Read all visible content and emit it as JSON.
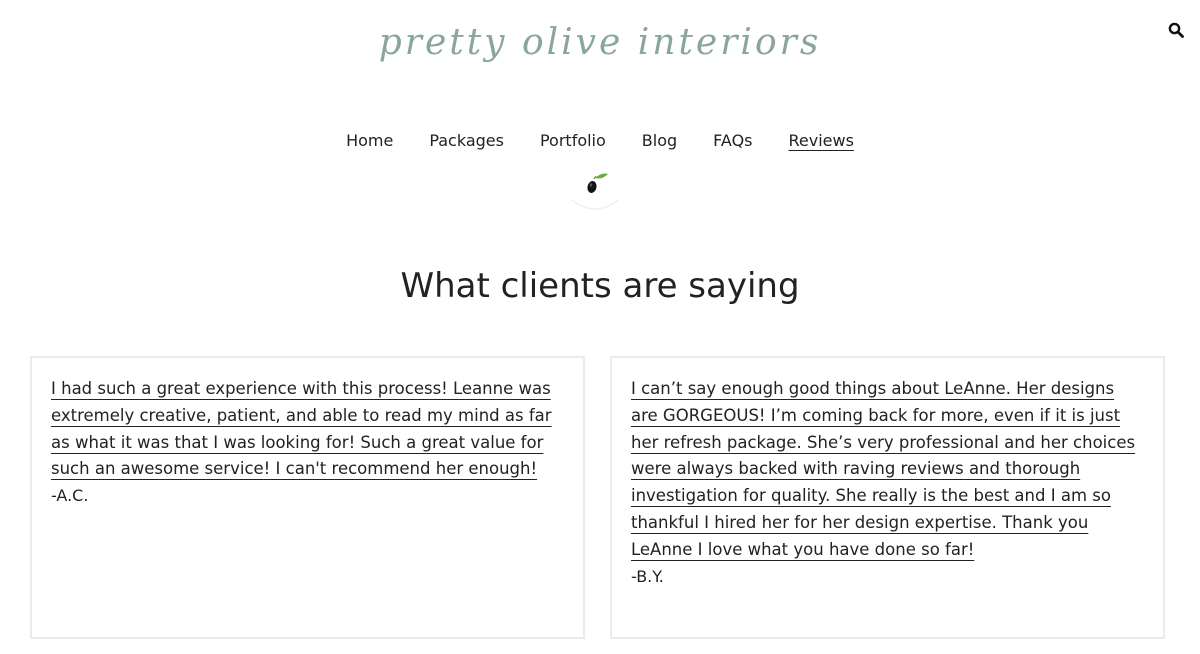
{
  "header": {
    "logo_text": "pretty olive interiors",
    "search_icon": "search-icon"
  },
  "nav": {
    "items": [
      {
        "label": "Home",
        "active": false
      },
      {
        "label": "Packages",
        "active": false
      },
      {
        "label": "Portfolio",
        "active": false
      },
      {
        "label": "Blog",
        "active": false
      },
      {
        "label": "FAQs",
        "active": false
      },
      {
        "label": "Reviews",
        "active": true
      }
    ]
  },
  "divider_icon": "olive-icon",
  "main": {
    "heading": "What clients are saying",
    "testimonials": [
      {
        "quote": "I had such a great experience with this process! Leanne was extremely creative, patient, and able to read my mind as far as what it was that I was looking for! Such a great value for such an awesome service! I can't recommend her enough!",
        "author": "-A.C."
      },
      {
        "quote": "I can’t say enough good things about LeAnne. Her designs are GORGEOUS! I’m coming back for more, even if it is just her refresh package. She’s very professional and her choices were always backed with raving reviews and thorough investigation for quality. She really is the best and I am so thankful I hired her for her design expertise. Thank you LeAnne I love what you have done so far!",
        "author": "-B.Y."
      }
    ]
  },
  "colors": {
    "logo": "#8aa59c",
    "text": "#222222",
    "card_border": "#ebebeb",
    "olive_leaf": "#6cab3c"
  }
}
